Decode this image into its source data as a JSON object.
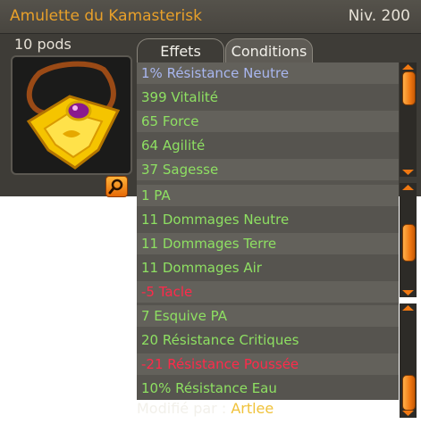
{
  "header": {
    "item_name": "Amulette du Kamasterisk",
    "level": "Niv. 200"
  },
  "item": {
    "weight": "10 pods"
  },
  "tabs": [
    {
      "label": "Effets",
      "active": true
    },
    {
      "label": "Conditions",
      "active": false
    }
  ],
  "icons": {
    "zoom": "magnifier-icon",
    "portrait": "amulet-icon"
  },
  "colors": {
    "positive": "#8ee062",
    "neutral_res": "#a9b7f0",
    "negative": "#ff2a4a",
    "accent": "#f07812"
  },
  "panels": [
    {
      "rows": [
        {
          "text": "1% Résistance Neutre",
          "tone": "blue"
        },
        {
          "text": "399 Vitalité",
          "tone": "green"
        },
        {
          "text": "65 Force",
          "tone": "green"
        },
        {
          "text": "64 Agilité",
          "tone": "green"
        },
        {
          "text": "37 Sagesse",
          "tone": "green"
        }
      ]
    },
    {
      "rows": [
        {
          "text": "1 PA",
          "tone": "green"
        },
        {
          "text": "11 Dommages Neutre",
          "tone": "green"
        },
        {
          "text": "11 Dommages Terre",
          "tone": "green"
        },
        {
          "text": "11 Dommages Air",
          "tone": "green"
        },
        {
          "text": "-5 Tacle",
          "tone": "red"
        }
      ]
    },
    {
      "rows": [
        {
          "text": "7 Esquive PA",
          "tone": "green"
        },
        {
          "text": "20 Résistance Critiques",
          "tone": "green"
        },
        {
          "text": "-21 Résistance Poussée",
          "tone": "red"
        },
        {
          "text": "10% Résistance Eau",
          "tone": "green"
        }
      ]
    }
  ],
  "footer": {
    "label": "Modifié par : ",
    "author": "Artlee"
  }
}
